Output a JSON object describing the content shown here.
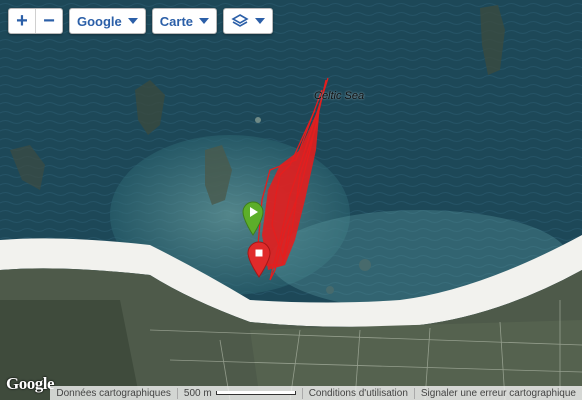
{
  "controls": {
    "zoom_in": "+",
    "zoom_out": "−",
    "provider_label": "Google",
    "map_type_label": "Carte",
    "layers_icon": "layers-icon"
  },
  "map": {
    "sea_label": "Celtic Sea",
    "logo_text": "Google"
  },
  "footer": {
    "data_label": "Données cartographiques",
    "scale_label": "500 m",
    "terms_label": "Conditions d'utilisation",
    "report_label": "Signaler une erreur cartographique"
  },
  "markers": {
    "start_icon": "play-icon",
    "end_icon": "stop-icon",
    "track_color": "#e31e1e",
    "start_color": "#5cae2a",
    "end_color": "#e02a2a"
  }
}
